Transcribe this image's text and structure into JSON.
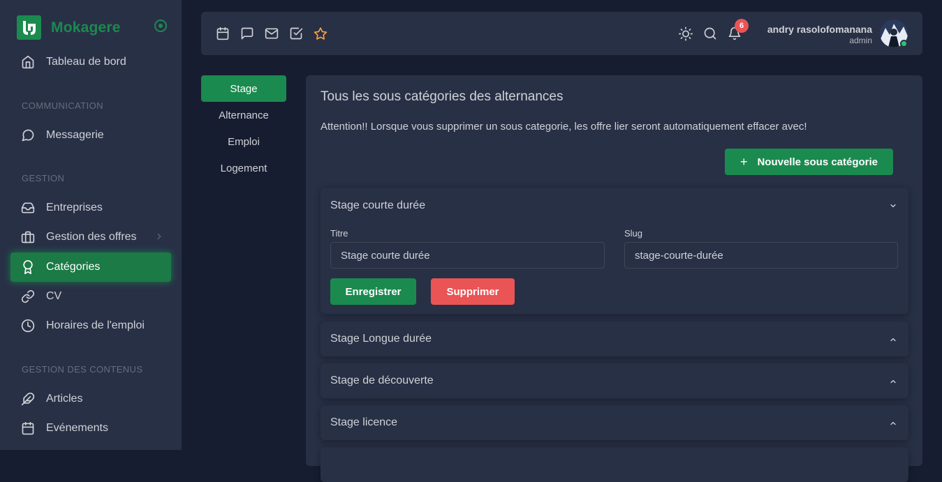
{
  "app": {
    "brand": "Mokagere"
  },
  "sidebar": {
    "items": [
      {
        "label": "Tableau de bord",
        "icon": "home-icon"
      },
      {
        "label": "Messagerie",
        "icon": "message-circle-icon"
      },
      {
        "label": "Entreprises",
        "icon": "inbox-icon"
      },
      {
        "label": "Gestion des offres",
        "icon": "briefcase-icon"
      },
      {
        "label": "Catégories",
        "icon": "award-icon",
        "active": true
      },
      {
        "label": "CV",
        "icon": "link-icon"
      },
      {
        "label": "Horaires de l'emploi",
        "icon": "clock-icon"
      },
      {
        "label": "Articles",
        "icon": "feather-icon"
      },
      {
        "label": "Evénements",
        "icon": "calendar-icon"
      }
    ],
    "headers": [
      "COMMUNICATION",
      "GESTION",
      "GESTION DES CONTENUS"
    ]
  },
  "topbar": {
    "notification_count": "6",
    "user_name": "andry rasolofomanana",
    "user_role": "admin"
  },
  "subnav": {
    "items": [
      {
        "label": "Stage",
        "active": true
      },
      {
        "label": "Alternance"
      },
      {
        "label": "Emploi"
      },
      {
        "label": "Logement"
      }
    ]
  },
  "main": {
    "title": "Tous les sous catégories des alternances",
    "note": "Attention!! Lorsque vous supprimer un sous categorie, les offre lier seront automatiquement effacer avec!",
    "new_button": "Nouvelle sous catégorie",
    "accordions": [
      {
        "title": "Stage courte durée",
        "expanded": true,
        "titre_label": "Titre",
        "titre_value": "Stage courte durée",
        "slug_label": "Slug",
        "slug_value": "stage-courte-durée",
        "save_label": "Enregistrer",
        "delete_label": "Supprimer"
      },
      {
        "title": "Stage Longue durée",
        "expanded": false
      },
      {
        "title": "Stage de découverte",
        "expanded": false
      },
      {
        "title": "Stage licence",
        "expanded": false
      }
    ]
  },
  "colors": {
    "accent": "#1b8a4f",
    "danger": "#ea5455",
    "sidebar": "#283046",
    "background": "#161d31"
  }
}
